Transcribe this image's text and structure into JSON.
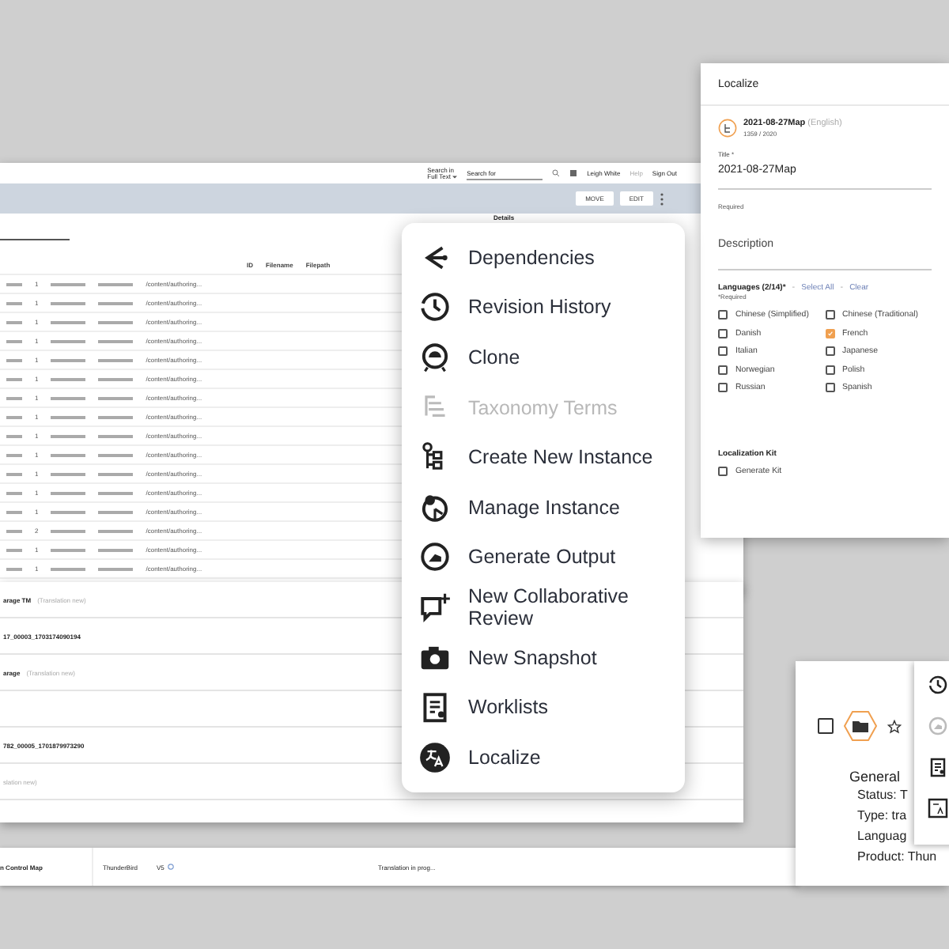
{
  "main_window": {
    "header": {
      "search_in_label": "Search in",
      "search_in_value": "Full Text",
      "search_placeholder": "Search for",
      "user": "Leigh White",
      "help": "Help",
      "sign_out": "Sign Out"
    },
    "toolbar": {
      "buttons": [
        "MOVE",
        "EDIT"
      ],
      "details": "Details"
    },
    "table": {
      "columns": [
        "ID",
        "Filename",
        "Filepath"
      ],
      "rows": [
        {
          "count": "1",
          "path": "/content/authoring..."
        },
        {
          "count": "1",
          "path": "/content/authoring..."
        },
        {
          "count": "1",
          "path": "/content/authoring..."
        },
        {
          "count": "1",
          "path": "/content/authoring..."
        },
        {
          "count": "1",
          "path": "/content/authoring..."
        },
        {
          "count": "1",
          "path": "/content/authoring..."
        },
        {
          "count": "1",
          "path": "/content/authoring..."
        },
        {
          "count": "1",
          "path": "/content/authoring..."
        },
        {
          "count": "1",
          "path": "/content/authoring..."
        },
        {
          "count": "1",
          "path": "/content/authoring..."
        },
        {
          "count": "1",
          "path": "/content/authoring..."
        },
        {
          "count": "1",
          "path": "/content/authoring..."
        },
        {
          "count": "1",
          "path": "/content/authoring..."
        },
        {
          "count": "2",
          "path": "/content/authoring..."
        },
        {
          "count": "1",
          "path": "/content/authoring..."
        },
        {
          "count": "1",
          "path": "/content/authoring..."
        }
      ]
    }
  },
  "list_window": {
    "rows": [
      {
        "title": "arage TM",
        "note": "(Translation new)"
      },
      {
        "title": "17_00003_1703174090194",
        "note": ""
      },
      {
        "title": "arage",
        "note": "(Translation new)"
      },
      {
        "title": "",
        "note": ""
      },
      {
        "title": "782_00005_1701879973290",
        "note": ""
      },
      {
        "title": "",
        "note": "slation new)"
      }
    ]
  },
  "strip": {
    "name": "n Control Map",
    "product": "ThunderBird",
    "version": "V5",
    "status": "Translation in prog..."
  },
  "context_menu": {
    "items": [
      {
        "label": "Dependencies",
        "disabled": false
      },
      {
        "label": "Revision History",
        "disabled": false
      },
      {
        "label": "Clone",
        "disabled": false
      },
      {
        "label": "Taxonomy Terms",
        "disabled": true
      },
      {
        "label": "Create New Instance",
        "disabled": false
      },
      {
        "label": "Manage Instance",
        "disabled": false
      },
      {
        "label": "Generate Output",
        "disabled": false
      },
      {
        "label": "New Collaborative Review",
        "disabled": false
      },
      {
        "label": "New Snapshot",
        "disabled": false
      },
      {
        "label": "Worklists",
        "disabled": false
      },
      {
        "label": "Localize",
        "disabled": false
      }
    ]
  },
  "localize": {
    "title": "Localize",
    "map_name": "2021-08-27Map",
    "map_language": "(English)",
    "map_id": "1359 / 2020",
    "title_label": "Title *",
    "title_value": "2021-08-27Map",
    "title_hint": "Required",
    "description_placeholder": "Description",
    "languages_label": "Languages (2/14)*",
    "separator": "-",
    "select_all": "Select All",
    "clear": "Clear",
    "required_note": "*Required",
    "languages": [
      {
        "label": "Chinese (Simplified)",
        "checked": false
      },
      {
        "label": "Chinese (Traditional)",
        "checked": false
      },
      {
        "label": "Danish",
        "checked": false
      },
      {
        "label": "French",
        "checked": true
      },
      {
        "label": "Italian",
        "checked": false
      },
      {
        "label": "Japanese",
        "checked": false
      },
      {
        "label": "Norwegian",
        "checked": false
      },
      {
        "label": "Polish",
        "checked": false
      },
      {
        "label": "Russian",
        "checked": false
      },
      {
        "label": "Spanish",
        "checked": false
      }
    ],
    "kit_label": "Localization Kit",
    "generate_kit": {
      "label": "Generate Kit",
      "checked": false
    }
  },
  "detail_card": {
    "checked": false,
    "section": "General",
    "fields": [
      {
        "key": "Status:",
        "value": "T"
      },
      {
        "key": "Type:",
        "value": "tra"
      },
      {
        "key": "Languag"
      },
      {
        "key": "Product:",
        "value": "Thun"
      }
    ]
  }
}
